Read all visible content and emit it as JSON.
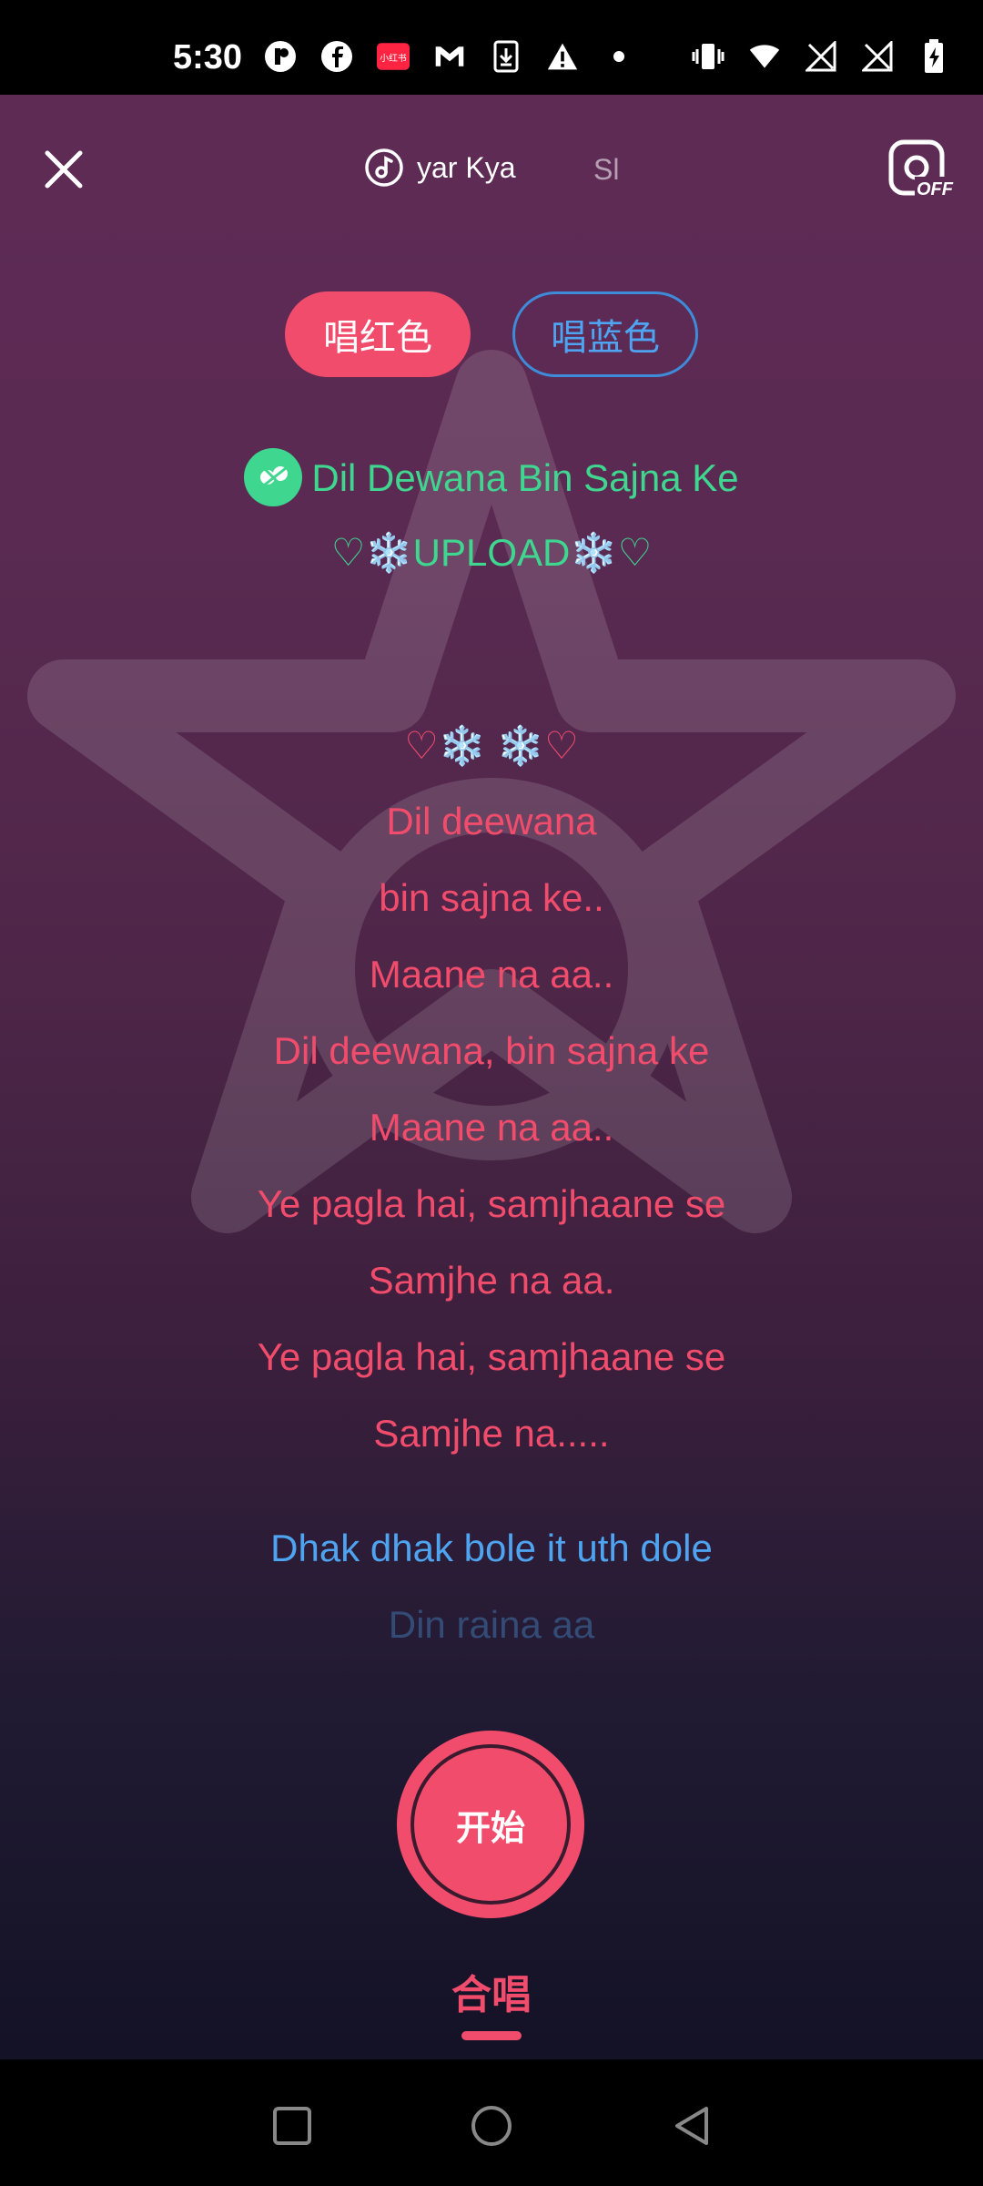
{
  "status_bar": {
    "time": "5:30",
    "left_icons": [
      "app-icon",
      "facebook-icon",
      "xiaohongshu-icon",
      "gmail-icon",
      "download-icon",
      "warning-icon",
      "dot-icon"
    ],
    "xiaohongshu_label": "小红书",
    "right_icons": [
      "vibrate-icon",
      "wifi-icon",
      "no-signal-icon",
      "no-signal-icon",
      "battery-charging-icon"
    ]
  },
  "top": {
    "song_title": "yar Kya",
    "next_song_fragment": "Sl",
    "camera_state": "OFF"
  },
  "parts": {
    "red_label": "唱红色",
    "blue_label": "唱蓝色",
    "selected": "red"
  },
  "lyrics": {
    "header_title": "Dil Dewana Bin Sajna Ke",
    "header_sub": "♡❄️UPLOAD❄️♡",
    "lines": [
      {
        "text": "♡❄️ ❄️♡",
        "part": "red"
      },
      {
        "text": "Dil deewana",
        "part": "red"
      },
      {
        "text": "bin sajna ke..",
        "part": "red"
      },
      {
        "text": "Maane na aa..",
        "part": "red"
      },
      {
        "text": "Dil deewana, bin sajna ke",
        "part": "red"
      },
      {
        "text": "Maane na aa..",
        "part": "red"
      },
      {
        "text": "Ye pagla hai, samjhaane se",
        "part": "red"
      },
      {
        "text": "Samjhe na aa.",
        "part": "red"
      },
      {
        "text": "Ye pagla hai, samjhaane se",
        "part": "red"
      },
      {
        "text": "Samjhe na.....",
        "part": "red"
      },
      {
        "text": "Dhak dhak bole it uth dole",
        "part": "blue"
      },
      {
        "text": "Din raina aa",
        "part": "blue-faded"
      }
    ]
  },
  "controls": {
    "start_label": "开始",
    "mode_label": "合唱"
  },
  "colors": {
    "accent_red": "#f24c6c",
    "accent_blue": "#4ea4f0",
    "accent_green": "#3fd68f"
  }
}
